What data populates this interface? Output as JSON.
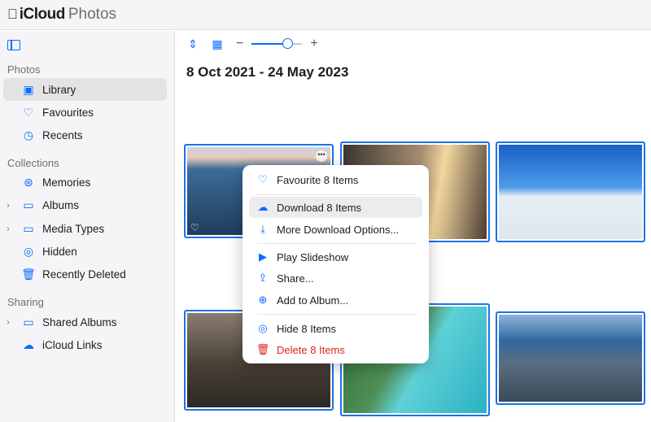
{
  "header": {
    "brand": "iCloud",
    "app": "Photos"
  },
  "sidebar": {
    "sections": [
      {
        "label": "Photos"
      },
      {
        "label": "Collections"
      },
      {
        "label": "Sharing"
      }
    ],
    "items": [
      {
        "label": "Library",
        "icon": "library-icon"
      },
      {
        "label": "Favourites",
        "icon": "heart-icon"
      },
      {
        "label": "Recents",
        "icon": "clock-icon"
      },
      {
        "label": "Memories",
        "icon": "memories-icon"
      },
      {
        "label": "Albums",
        "icon": "albums-icon"
      },
      {
        "label": "Media Types",
        "icon": "media-types-icon"
      },
      {
        "label": "Hidden",
        "icon": "eye-slash-icon"
      },
      {
        "label": "Recently Deleted",
        "icon": "trash-icon"
      },
      {
        "label": "Shared Albums",
        "icon": "shared-albums-icon"
      },
      {
        "label": "iCloud Links",
        "icon": "cloud-link-icon"
      }
    ]
  },
  "toolbar": {
    "minus": "−",
    "plus": "+",
    "zoom_level": 0.7
  },
  "main": {
    "date_range": "8 Oct 2021 - 24 May 2023"
  },
  "menu": {
    "items": [
      {
        "label": "Favourite 8 Items"
      },
      {
        "label": "Download 8 Items"
      },
      {
        "label": "More Download Options..."
      },
      {
        "label": "Play Slideshow"
      },
      {
        "label": "Share..."
      },
      {
        "label": "Add to Album..."
      },
      {
        "label": "Hide 8 Items"
      },
      {
        "label": "Delete 8 Items"
      }
    ]
  },
  "colors": {
    "accent": "#0a6cff",
    "danger": "#e0201b",
    "selection": "#1a73e8"
  }
}
